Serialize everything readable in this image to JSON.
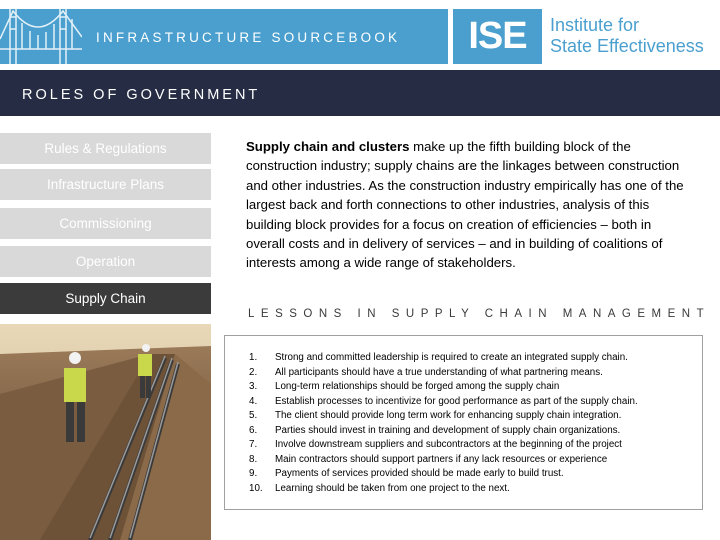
{
  "banner": {
    "title": "INFRASTRUCTURE SOURCEBOOK",
    "logo": "ISE",
    "institute_line1": "Institute for",
    "institute_line2": "State Effectiveness"
  },
  "section": {
    "title": "ROLES OF GOVERNMENT"
  },
  "nav": {
    "items": [
      {
        "label": "Rules & Regulations",
        "active": false
      },
      {
        "label": "Infrastructure Plans",
        "active": false
      },
      {
        "label": "Commissioning",
        "active": false
      },
      {
        "label": "Operation",
        "active": false
      },
      {
        "label": "Supply Chain",
        "active": true
      }
    ]
  },
  "intro": {
    "bold": "Supply chain and clusters",
    "text": " make up the fifth building block of the construction industry; supply chains are the linkages between construction and other industries. As the construction industry empirically has one of the largest back and forth connections to other industries, analysis of this building block provides for a focus on creation of efficiencies – both in overall costs and in delivery of services – and in building of coalitions of interests among a wide range of stakeholders."
  },
  "lessons": {
    "heading": "LESSONS IN SUPPLY CHAIN MANAGEMENT",
    "items": [
      {
        "num": "1.",
        "text": "Strong and committed leadership is required to create an integrated supply chain."
      },
      {
        "num": "2.",
        "text": "All participants should have a true understanding of what partnering means."
      },
      {
        "num": "3.",
        "text": "Long-term relationships should be forged among the supply chain"
      },
      {
        "num": "4.",
        "text": "Establish processes to incentivize for good performance as part of the supply chain."
      },
      {
        "num": "5.",
        "text": "The client should provide long term work for enhancing supply chain integration."
      },
      {
        "num": "6.",
        "text": "Parties should invest in training and development of supply chain organizations."
      },
      {
        "num": "7.",
        "text": "Involve downstream suppliers and subcontractors at the beginning of the project"
      },
      {
        "num": "8.",
        "text": "Main contractors should support partners if any lack resources or experience"
      },
      {
        "num": "9.",
        "text": "Payments of services provided should be made early to build trust."
      },
      {
        "num": "10.",
        "text": "Learning should be taken from one project to the next."
      }
    ]
  },
  "colors": {
    "brand_blue": "#4a9fcf",
    "navy": "#252c44",
    "nav_inactive": "#d9d9d9",
    "nav_active": "#3b3b3b"
  }
}
